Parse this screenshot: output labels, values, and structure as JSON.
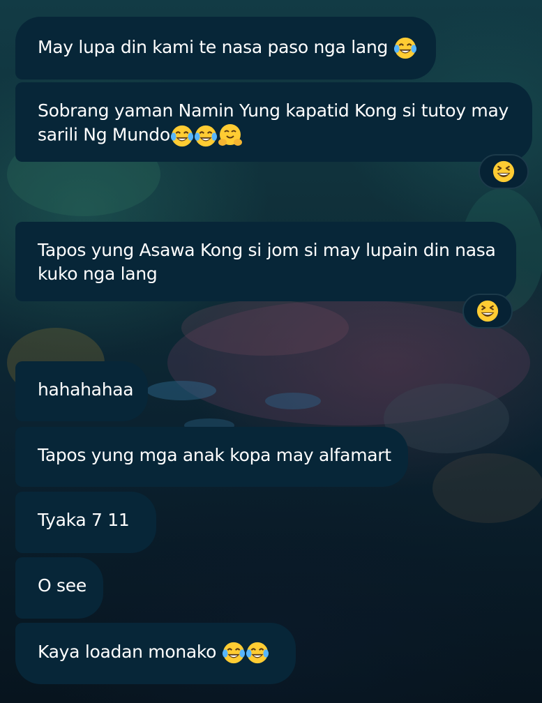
{
  "messages": [
    {
      "text": "May lupa din kami te nasa paso nga lang",
      "emojis": [
        "tears-of-joy"
      ]
    },
    {
      "text": "Sobrang yaman Namin Yung kapatid Kong si tutoy may sarili Ng Mundo",
      "emojis": [
        "tears-of-joy",
        "tears-of-joy",
        "hugging-face"
      ]
    },
    {
      "text": "",
      "emojis": [
        "grinning-squinting"
      ]
    },
    {
      "text": "Tapos yung Asawa Kong si jom si may lupain din nasa kuko nga lang",
      "emojis": []
    },
    {
      "text": "",
      "emojis": [
        "grinning-squinting"
      ]
    },
    {
      "text": "hahahahaa",
      "emojis": []
    },
    {
      "text": "Tapos yung mga anak kopa may alfamart",
      "emojis": []
    },
    {
      "text": "Tyaka 7 11",
      "emojis": []
    },
    {
      "text": "O see",
      "emojis": []
    },
    {
      "text": "Kaya loadan monako",
      "emojis": [
        "tears-of-joy",
        "tears-of-joy"
      ]
    }
  ],
  "colors": {
    "bubble": "#072638",
    "text": "#ffffff",
    "emoji_face": "#ffcc33"
  }
}
